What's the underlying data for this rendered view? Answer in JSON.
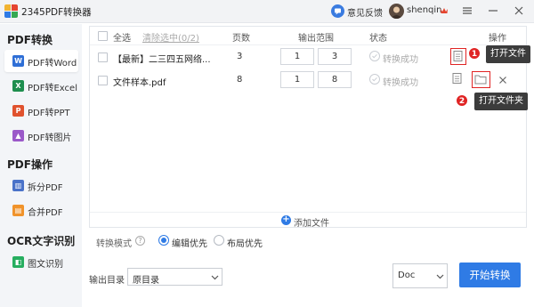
{
  "app": {
    "title": "2345PDF转换器"
  },
  "titlebar": {
    "feedback_label": "意见反馈",
    "username": "shenqin"
  },
  "sidebar": {
    "sections": [
      {
        "title": "PDF转换",
        "items": [
          {
            "label": "PDF转Word",
            "icon": "W",
            "color": "#2f6fd6",
            "active": true
          },
          {
            "label": "PDF转Excel",
            "icon": "X",
            "color": "#1e8e4e"
          },
          {
            "label": "PDF转PPT",
            "icon": "P",
            "color": "#e0522e"
          },
          {
            "label": "PDF转图片",
            "icon": "▲",
            "color": "#9b59c9"
          }
        ]
      },
      {
        "title": "PDF操作",
        "items": [
          {
            "label": "拆分PDF",
            "icon": "▥",
            "color": "#4a72c9"
          },
          {
            "label": "合并PDF",
            "icon": "▤",
            "color": "#f0932b"
          }
        ]
      },
      {
        "title": "OCR文字识别",
        "items": [
          {
            "label": "图文识别",
            "icon": "◧",
            "color": "#27ae60"
          }
        ]
      }
    ]
  },
  "table": {
    "headers": {
      "select_all": "全选",
      "clear_selected": "清除选中(0/2)",
      "pages": "页数",
      "range": "输出范围",
      "status": "状态",
      "actions": "操作"
    },
    "rows": [
      {
        "name": "【最新】二三四五网络...",
        "pages": "3",
        "range_from": "1",
        "range_to": "3",
        "range_sep": "-",
        "status": "转换成功"
      },
      {
        "name": "文件样本.pdf",
        "pages": "8",
        "range_from": "1",
        "range_to": "8",
        "range_sep": "-",
        "status": "转换成功"
      }
    ],
    "add_file_label": "添加文件"
  },
  "annotations": {
    "badge1": "1",
    "tip1": "打开文件",
    "badge2": "2",
    "tip2": "打开文件夹",
    "highlight_color": "#e02424"
  },
  "mode": {
    "label": "转换模式",
    "help": "?",
    "options": [
      {
        "label": "编辑优先",
        "selected": true
      },
      {
        "label": "布局优先",
        "selected": false
      }
    ]
  },
  "output": {
    "label": "输出目录",
    "dir_value": "原目录",
    "format_value": "Doc"
  },
  "start_button": "开始转换",
  "colors": {
    "accent": "#2f7be5",
    "badge": "#e02424"
  }
}
